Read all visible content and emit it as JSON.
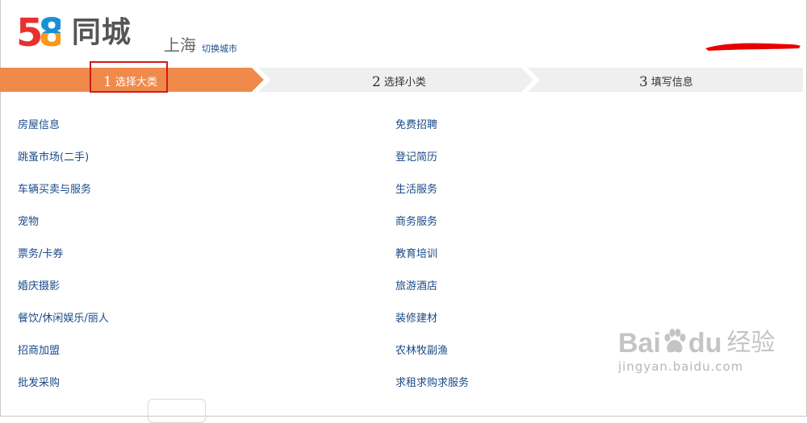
{
  "header": {
    "logo_number": [
      "5",
      "8"
    ],
    "logo_name": "同城",
    "city": "上海",
    "switch_city": "切换城市"
  },
  "steps": [
    {
      "num": "1",
      "label": "选择大类",
      "active": true
    },
    {
      "num": "2",
      "label": "选择小类",
      "active": false
    },
    {
      "num": "3",
      "label": "填写信息",
      "active": false
    }
  ],
  "categories": {
    "left": [
      "房屋信息",
      "跳蚤市场(二手)",
      "车辆买卖与服务",
      "宠物",
      "票务/卡券",
      "婚庆摄影",
      "餐饮/休闲娱乐/丽人",
      "招商加盟",
      "批发采购"
    ],
    "right": [
      "免费招聘",
      "登记简历",
      "生活服务",
      "商务服务",
      "教育培训",
      "旅游酒店",
      "装修建材",
      "农林牧副渔",
      "求租求购求服务"
    ]
  },
  "watermark": {
    "brand_a": "Bai",
    "brand_b": "du",
    "brand_cn": "经验",
    "url": "jingyan.baidu.com"
  },
  "colors": {
    "logo_5": "#e8312f",
    "logo_8a": "#1a8fd8",
    "logo_8b": "#f59a1c",
    "step_active": "#f08a4b",
    "step_inactive": "#efefef",
    "highlight_box": "#d21a1a",
    "redaction": "#e80000",
    "link": "#1a4a88"
  }
}
